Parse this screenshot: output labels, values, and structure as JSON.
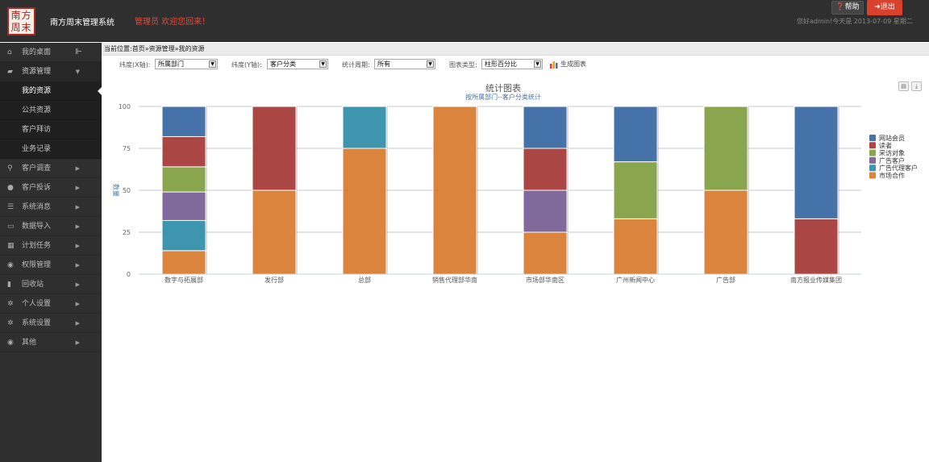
{
  "header": {
    "logo_text": "南方周末",
    "app_title": "南方周末管理系统",
    "welcome": "管理员 欢迎您回来！",
    "help_label": "帮助",
    "logout_label": "退出",
    "user_info": "您好admin!今天是  2013-07-09 星期二"
  },
  "sidebar": {
    "items": [
      {
        "label": "我的桌面",
        "icon": "home-icon"
      },
      {
        "label": "资源管理",
        "icon": "folder-icon"
      },
      {
        "label": "客户调查",
        "icon": "search-icon"
      },
      {
        "label": "客户投诉",
        "icon": "question-icon"
      },
      {
        "label": "系统消息",
        "icon": "list-icon"
      },
      {
        "label": "数据导入",
        "icon": "inbox-icon"
      },
      {
        "label": "计划任务",
        "icon": "calendar-icon"
      },
      {
        "label": "权限管理",
        "icon": "globe-icon"
      },
      {
        "label": "回收站",
        "icon": "trash-icon"
      },
      {
        "label": "个人设置",
        "icon": "gear-icon"
      },
      {
        "label": "系统设置",
        "icon": "gear-icon"
      },
      {
        "label": "其他",
        "icon": "globe-icon"
      }
    ],
    "sub_items": [
      {
        "label": "我的资源"
      },
      {
        "label": "公共资源"
      },
      {
        "label": "客户拜访"
      },
      {
        "label": "业务记录"
      }
    ]
  },
  "breadcrumb": "当前位置:首页»资源管理»我的资源",
  "filters": {
    "x_label": "纬度(X轴):",
    "x_value": "所属部门",
    "y_label": "纬度(Y轴):",
    "y_value": "客户分类",
    "period_label": "统计周期:",
    "period_value": "所有",
    "type_label": "图表类型:",
    "type_value": "柱形百分比",
    "generate_label": "生成图表"
  },
  "colors": {
    "accent": "#d9412f",
    "series": [
      "#4572a7",
      "#aa4643",
      "#89a54e",
      "#80699b",
      "#3d96ae",
      "#db843d"
    ]
  },
  "chart_data": {
    "type": "bar",
    "stacked_percent": true,
    "title": "统计图表",
    "subtitle": "按所属部门--客户分类统计",
    "ylabel": "数量",
    "ylim": [
      0,
      100
    ],
    "yticks": [
      0,
      25,
      50,
      75,
      100
    ],
    "grid": true,
    "legend_position": "right",
    "categories": [
      "数字与拓展部",
      "发行部",
      "总部",
      "销售代理部华南",
      "市场部华南区",
      "广州新闻中心",
      "广告部",
      "南方报业传媒集团"
    ],
    "series": [
      {
        "name": "网站会员",
        "values": [
          18,
          0,
          0,
          0,
          25,
          33,
          0,
          67
        ]
      },
      {
        "name": "读者",
        "values": [
          18,
          50,
          0,
          0,
          25,
          0,
          0,
          33
        ]
      },
      {
        "name": "采访对象",
        "values": [
          15,
          0,
          0,
          0,
          0,
          34,
          50,
          0
        ]
      },
      {
        "name": "广告客户",
        "values": [
          17,
          0,
          0,
          0,
          25,
          0,
          0,
          0
        ]
      },
      {
        "name": "广告代理客户",
        "values": [
          18,
          0,
          25,
          0,
          0,
          0,
          0,
          0
        ]
      },
      {
        "name": "市场合作",
        "values": [
          14,
          50,
          75,
          100,
          25,
          33,
          50,
          0
        ]
      }
    ]
  }
}
